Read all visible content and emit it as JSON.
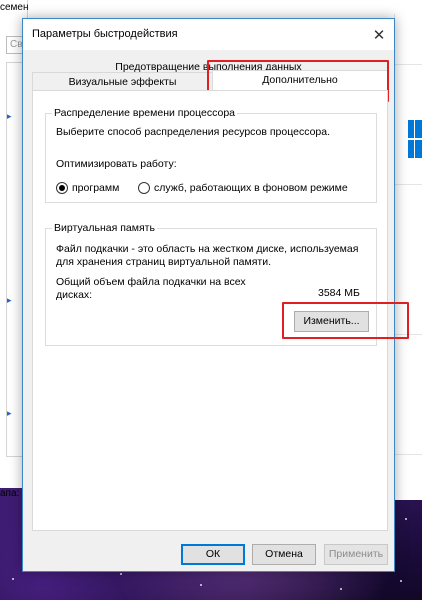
{
  "background": {
    "left_window_title": "семен",
    "left_input_text": "Св",
    "bottom_label": "апа:"
  },
  "dialog": {
    "title": "Параметры быстродействия",
    "close_glyph": "✕",
    "tabs": {
      "back_row": "Предотвращение выполнения данных",
      "visual": "Визуальные эффекты",
      "advanced": "Дополнительно"
    },
    "cpu": {
      "title": "Распределение времени процессора",
      "description": "Выберите способ распределения ресурсов процессора.",
      "optimize_label": "Оптимизировать работу:",
      "option_programs": "программ",
      "option_services": "служб, работающих в фоновом режиме",
      "selected": "программ"
    },
    "virtual_memory": {
      "title": "Виртуальная память",
      "description_line1": "Файл подкачки - это область на жестком диске, используемая",
      "description_line2": "для хранения страниц виртуальной памяти.",
      "total_label_line1": "Общий объем файла подкачки на всех",
      "total_label_line2": "дисках:",
      "total_value": "3584 МБ",
      "change_button": "Изменить..."
    },
    "buttons": {
      "ok": "ОК",
      "cancel": "Отмена",
      "apply": "Применить"
    }
  },
  "colors": {
    "accent": "#0078d7",
    "highlight": "#e02020",
    "windows_logo": "#0078d7"
  }
}
